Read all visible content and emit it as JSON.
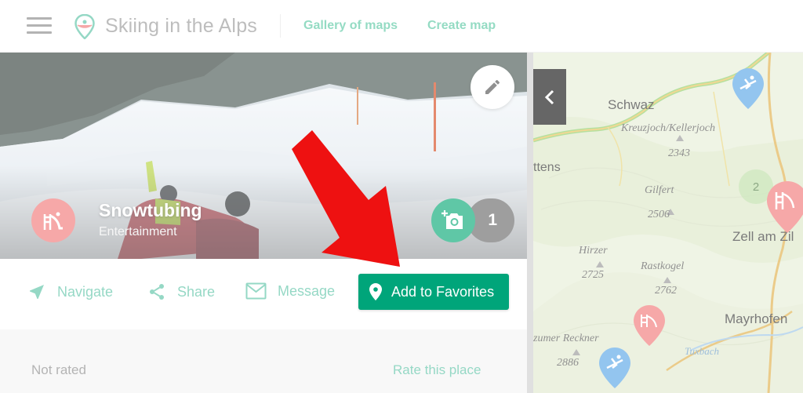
{
  "header": {
    "app_title": "Skiing in the Alps",
    "nav": [
      {
        "label": "Gallery of maps"
      },
      {
        "label": "Create map"
      }
    ]
  },
  "place": {
    "name": "Snowtubing",
    "category": "Entertainment",
    "photo_count": "1"
  },
  "actions": {
    "navigate": "Navigate",
    "share": "Share",
    "message": "Message",
    "add_favorites": "Add to Favorites"
  },
  "rating": {
    "status": "Not rated",
    "rate_link": "Rate this place"
  },
  "map": {
    "labels": [
      {
        "text": "Schwaz"
      },
      {
        "text": "Kreuzjoch/Kellerjoch"
      },
      {
        "text": "2343"
      },
      {
        "text": "ttens"
      },
      {
        "text": "Gilfert"
      },
      {
        "text": "2506"
      },
      {
        "text": "Zell am Zil"
      },
      {
        "text": "Hirzer"
      },
      {
        "text": "Rastkogel"
      },
      {
        "text": "2725"
      },
      {
        "text": "2762"
      },
      {
        "text": "Mayrhofen"
      },
      {
        "text": "zumer Reckner"
      },
      {
        "text": "Tuxbach"
      },
      {
        "text": "2886"
      }
    ],
    "cluster_count": "2"
  },
  "colors": {
    "accent": "#00a57a",
    "accent_light": "#5cc3a6",
    "marker_red": "#f27a7a",
    "marker_blue": "#5aa6e6",
    "annotation_arrow": "#ee1111"
  }
}
